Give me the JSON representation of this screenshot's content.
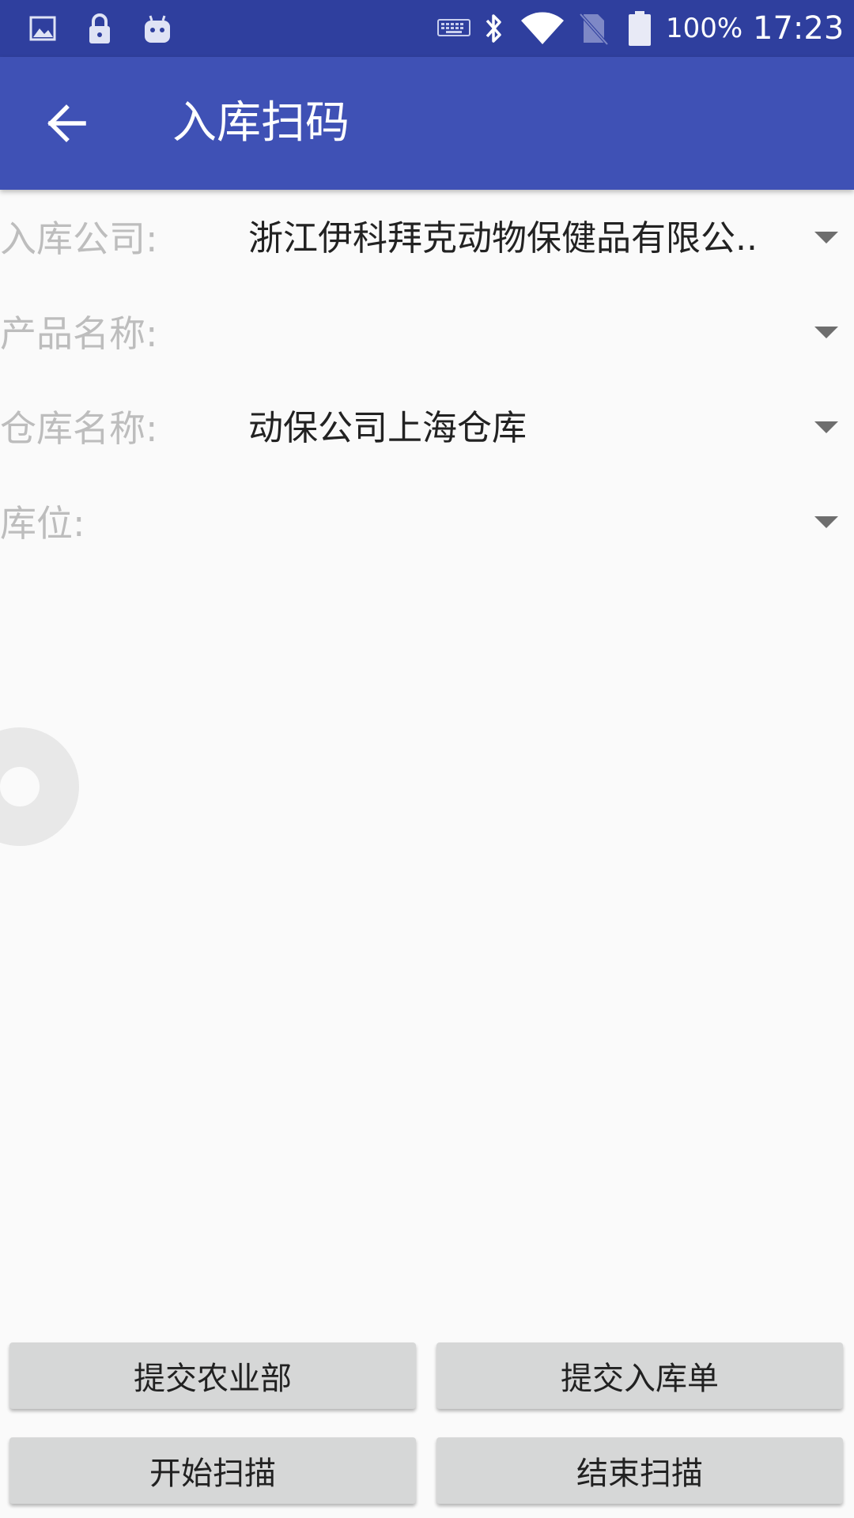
{
  "status_bar": {
    "icons_left": [
      "image-icon",
      "lock-icon",
      "android-icon"
    ],
    "icons_right": [
      "keyboard-icon",
      "bluetooth-icon",
      "wifi-icon",
      "no-sim-icon",
      "battery-icon"
    ],
    "battery": "100%",
    "time": "17:23"
  },
  "app_bar": {
    "title": "入库扫码",
    "back_icon": "arrow-back-icon",
    "color": "#3f51b5",
    "status_color": "#2f3f9e"
  },
  "form": {
    "company": {
      "label": "入库公司:",
      "value": "浙江伊科拜克动物保健品有限公.."
    },
    "product": {
      "label": "产品名称:",
      "value": ""
    },
    "warehouse": {
      "label": "仓库名称:",
      "value": "动保公司上海仓库"
    },
    "location": {
      "label": "库位:",
      "value": ""
    }
  },
  "buttons": {
    "submit_agriculture": "提交农业部",
    "submit_inbound": "提交入库单",
    "start_scan": "开始扫描",
    "end_scan": "结束扫描"
  }
}
